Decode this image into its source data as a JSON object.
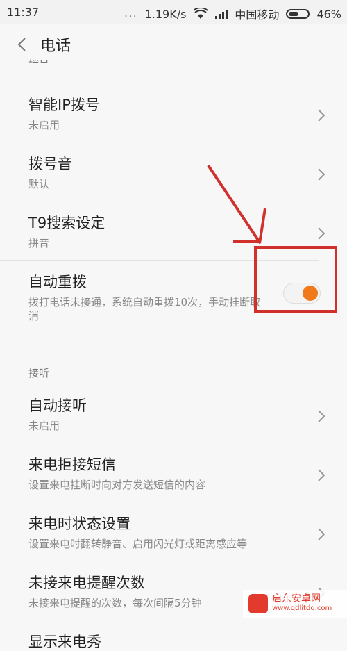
{
  "status_bar": {
    "time": "11:37",
    "dots": "...",
    "network_speed": "1.19K/s",
    "carrier": "中国移动",
    "battery": "46%"
  },
  "app_bar": {
    "title": "电话"
  },
  "list": {
    "section_top_partial": "拨号",
    "items": [
      {
        "title": "智能IP拨号",
        "subtitle": "未启用"
      },
      {
        "title": "拨号音",
        "subtitle": "默认"
      },
      {
        "title": "T9搜索设定",
        "subtitle": "拼音"
      },
      {
        "title": "自动重拨",
        "subtitle": "拨打电话未接通，系统自动重拨10次，手动挂断取消",
        "toggle_on": true
      }
    ],
    "section_answer": "接听",
    "items2": [
      {
        "title": "自动接听",
        "subtitle": "未启用"
      },
      {
        "title": "来电拒接短信",
        "subtitle": "设置来电挂断时向对方发送短信的内容"
      },
      {
        "title": "来电时状态设置",
        "subtitle": "设置来电时翻转静音、启用闪光灯或距离感应等"
      },
      {
        "title": "未接来电提醒次数",
        "subtitle": "未接来电提醒的次数，每次间隔5分钟"
      },
      {
        "title": "显示来电秀"
      }
    ]
  },
  "watermark": {
    "brand": "启东安卓网",
    "url": "www.qdlitdq.com"
  },
  "colors": {
    "toggle_on": "#f07a1b",
    "annotation_red": "#d0312d"
  }
}
